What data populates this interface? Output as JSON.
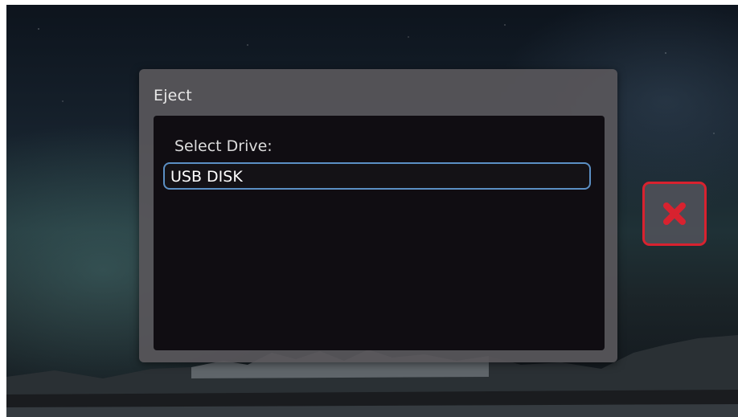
{
  "dialog": {
    "title": "Eject",
    "list_label": "Select Drive:",
    "drives": [
      {
        "label": "USB DISK",
        "selected": true
      }
    ]
  },
  "close_button": {
    "icon": "close-icon",
    "color": "#d8222f"
  },
  "colors": {
    "selection_border": "#5b8fc4",
    "dialog_bg": "#58565a",
    "list_bg": "#100d12"
  }
}
